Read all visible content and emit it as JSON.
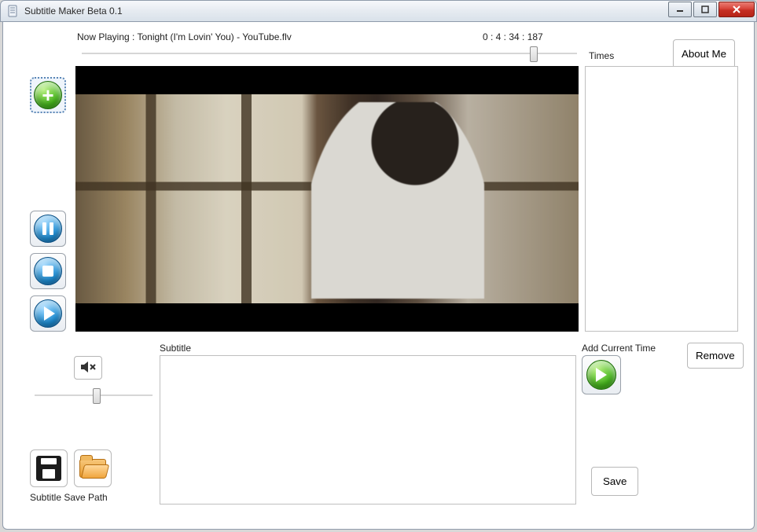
{
  "window": {
    "title": "Subtitle Maker Beta 0.1"
  },
  "header": {
    "now_playing": "Now Playing : Tonight (I'm Lovin' You) - YouTube.flv",
    "time_readout": "0 : 4 : 34 : 187",
    "about_label": "About Me",
    "times_label": "Times"
  },
  "seek": {
    "position_pct": 90
  },
  "controls": {
    "add_tooltip": "Add",
    "pause_tooltip": "Pause",
    "stop_tooltip": "Stop",
    "play_tooltip": "Play",
    "mute_tooltip": "Mute"
  },
  "volume": {
    "position_pct": 50
  },
  "subtitle": {
    "label": "Subtitle",
    "value": ""
  },
  "add_current": {
    "label": "Add Current Time"
  },
  "right": {
    "remove_label": "Remove",
    "save_label": "Save"
  },
  "bottom": {
    "save_path_label": "Subtitle Save Path"
  },
  "times_list": []
}
